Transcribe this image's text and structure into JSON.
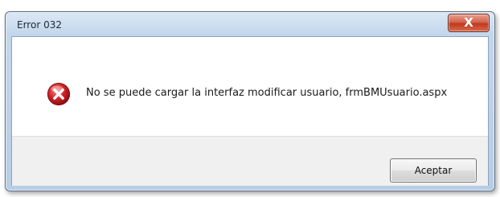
{
  "window": {
    "title": "Error 032",
    "close_glyph": "X",
    "close_icon": "close-icon",
    "accent_close": "#c7402a"
  },
  "dialog": {
    "icon": "error-icon",
    "icon_color": "#c8181d",
    "message": "No se puede cargar la interfaz modificar usuario, frmBMUsuario.aspx"
  },
  "buttons": {
    "ok_label": "Aceptar"
  }
}
